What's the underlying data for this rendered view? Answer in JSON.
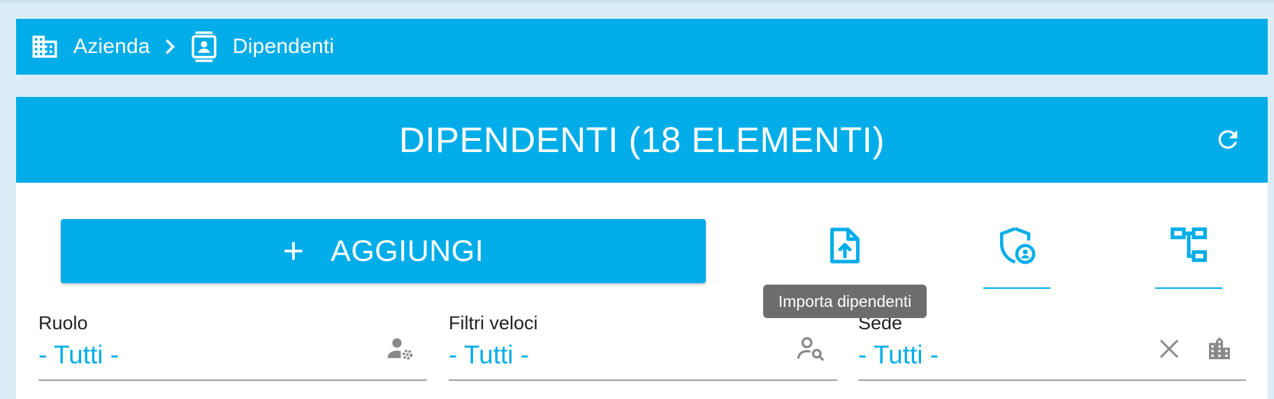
{
  "breadcrumb": {
    "items": [
      {
        "label": "Azienda",
        "icon": "building-icon"
      },
      {
        "label": "Dipendenti",
        "icon": "contact-card-icon"
      }
    ],
    "separator_icon": "chevron-right-icon"
  },
  "header": {
    "title": "DIPENDENTI (18 ELEMENTI)",
    "refresh_icon": "refresh-icon"
  },
  "toolbar": {
    "add_label": "AGGIUNGI",
    "add_icon": "plus-icon",
    "tabs": [
      {
        "name": "import",
        "icon": "file-upload-icon",
        "active": true
      },
      {
        "name": "security",
        "icon": "shield-user-icon",
        "active": false
      },
      {
        "name": "org-chart",
        "icon": "sitemap-icon",
        "active": false
      }
    ],
    "tooltip": "Importa dipendenti"
  },
  "filters": [
    {
      "label": "Ruolo",
      "value": "- Tutti -",
      "icon": "user-gear-icon"
    },
    {
      "label": "Filtri veloci",
      "value": "- Tutti -",
      "icon": "user-search-icon"
    },
    {
      "label": "Sede",
      "value": "- Tutti -",
      "icon": "building-icon",
      "clear_icon": "close-icon"
    }
  ],
  "colors": {
    "accent": "#00ade8",
    "background": "#daedf6",
    "tooltip": "#6d6d6d",
    "icon_gray": "#8a8a8a"
  }
}
